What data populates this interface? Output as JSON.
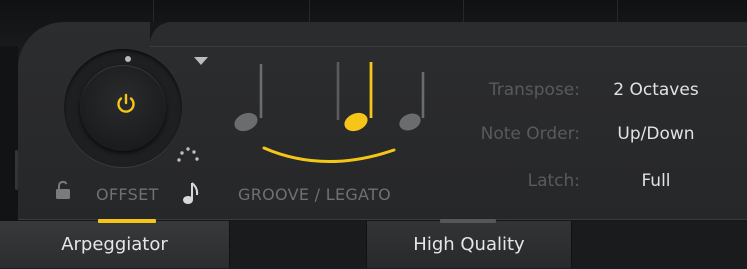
{
  "colors": {
    "accent": "#f5c518",
    "inactive_note": "#6b6c6e",
    "label": "#6f7072",
    "value": "#e2e2e2"
  },
  "knob": {
    "name": "OFFSET",
    "power_icon": "power-icon",
    "lock_icon": "unlock-icon",
    "note_icon": "eighth-note-icon"
  },
  "groove": {
    "label": "GROOVE / LEGATO",
    "active_note": 3,
    "note_count": 4
  },
  "params": [
    {
      "label": "Transpose:",
      "value": "2 Octaves"
    },
    {
      "label": "Note Order:",
      "value": "Up/Down"
    },
    {
      "label": "Latch:",
      "value": "Full"
    }
  ],
  "tabs": {
    "arpeggiator": "Arpeggiator",
    "high_quality": "High Quality"
  }
}
